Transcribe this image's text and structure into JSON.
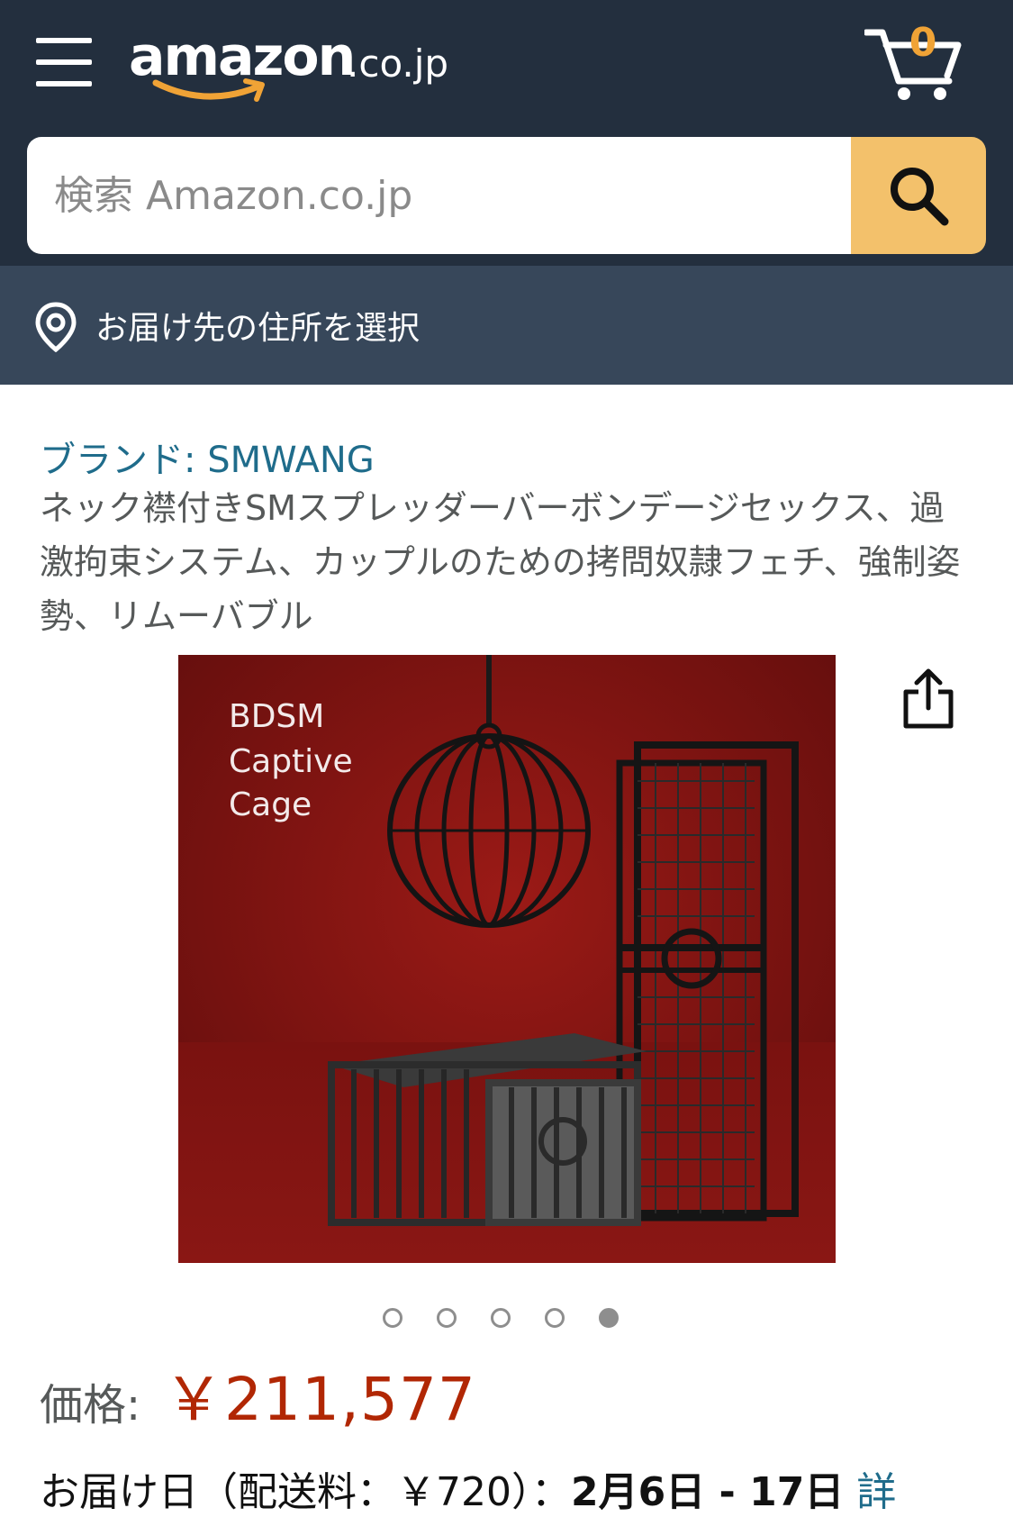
{
  "header": {
    "logo_word": "amazon",
    "logo_tld": ".co.jp",
    "cart_count": "0",
    "colors": {
      "nav_bg": "#232f3e",
      "subnav_bg": "#37475a",
      "accent": "#f3c16b",
      "smile": "#f0a336"
    }
  },
  "search": {
    "placeholder": "検索 Amazon.co.jp"
  },
  "deliver": {
    "label": "お届け先の住所を選択"
  },
  "product": {
    "brand": "ブランド: SMWANG",
    "title": "ネック襟付きSMスプレッダーバーボンデージセックス、過激拘束システム、カップルのための拷問奴隷フェチ、強制姿勢、リムーバブル",
    "image_text": [
      "BDSM",
      "Captive",
      "Cage"
    ],
    "carousel": {
      "total": 5,
      "active_index": 5
    },
    "price_label": "価格:",
    "price": "￥211,577",
    "delivery_prefix": "お届け日（配送料：￥720）：",
    "delivery_date": "2月6日 - 17日",
    "delivery_more": "詳"
  },
  "icons": {
    "menu": "hamburger-icon",
    "cart": "cart-icon",
    "search": "search-icon",
    "location": "location-pin-icon",
    "share": "share-icon"
  }
}
